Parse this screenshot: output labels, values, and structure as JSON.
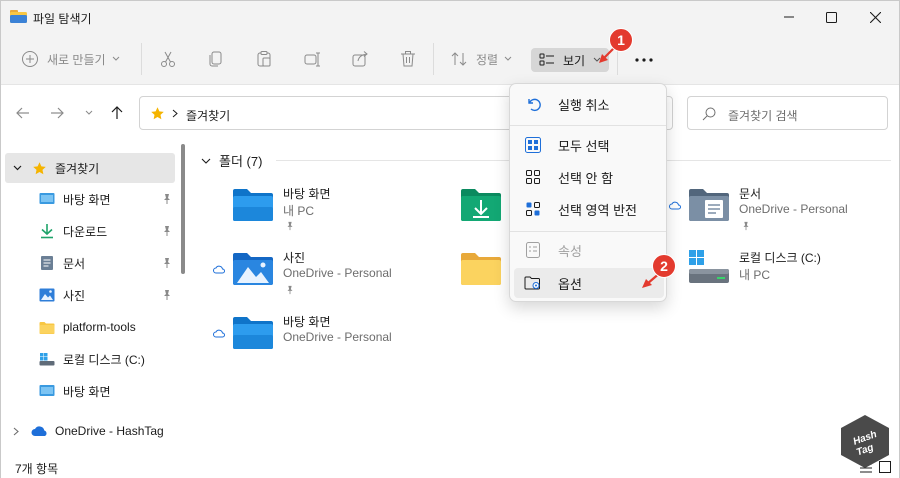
{
  "window": {
    "title": "파일 탐색기"
  },
  "toolbar": {
    "new_label": "새로 만들기",
    "sort_label": "정렬",
    "view_label": "보기"
  },
  "address": {
    "path": "즐겨찾기"
  },
  "search": {
    "placeholder": "즐겨찾기 검색"
  },
  "sidebar": {
    "items": [
      {
        "label": "즐겨찾기",
        "icon": "star-icon"
      },
      {
        "label": "바탕 화면",
        "icon": "desktop-icon"
      },
      {
        "label": "다운로드",
        "icon": "download-icon"
      },
      {
        "label": "문서",
        "icon": "document-icon"
      },
      {
        "label": "사진",
        "icon": "pictures-icon"
      },
      {
        "label": "platform-tools",
        "icon": "folder-icon"
      },
      {
        "label": "로컬 디스크 (C:)",
        "icon": "drive-icon"
      },
      {
        "label": "바탕 화면",
        "icon": "desktop-icon"
      },
      {
        "label": "OneDrive - HashTag",
        "icon": "onedrive-icon"
      }
    ]
  },
  "group": {
    "title": "폴더 (7)"
  },
  "tiles": [
    {
      "name": "바탕 화면",
      "sub": "내 PC",
      "icon": "desktop-folder-icon"
    },
    {
      "name": "",
      "sub": "",
      "icon": "download-folder-icon"
    },
    {
      "name": "문서",
      "sub": "OneDrive - Personal",
      "icon": "documents-folder-icon"
    },
    {
      "name": "사진",
      "sub": "OneDrive - Personal",
      "icon": "pictures-folder-icon"
    },
    {
      "name": "",
      "sub": "",
      "icon": "folder-icon"
    },
    {
      "name": "로컬 디스크 (C:)",
      "sub": "내 PC",
      "icon": "drive-icon"
    },
    {
      "name": "바탕 화면",
      "sub": "OneDrive - Personal",
      "icon": "desktop-folder-icon"
    }
  ],
  "menu": {
    "items": [
      {
        "label": "실행 취소",
        "icon": "undo-icon",
        "enabled": true
      },
      {
        "label": "모두 선택",
        "icon": "select-all-icon",
        "enabled": true
      },
      {
        "label": "선택 안 함",
        "icon": "select-none-icon",
        "enabled": true
      },
      {
        "label": "선택 영역 반전",
        "icon": "invert-selection-icon",
        "enabled": true
      },
      {
        "label": "속성",
        "icon": "properties-icon",
        "enabled": false
      },
      {
        "label": "옵션",
        "icon": "options-icon",
        "enabled": true
      }
    ]
  },
  "annotations": {
    "step1": "1",
    "step2": "2"
  },
  "status": {
    "text": "7개 항목"
  },
  "watermark": {
    "line1": "Hash",
    "line2": "Tag"
  },
  "colors": {
    "accent": "#0067c0",
    "folder_yellow": "#f8c744",
    "badge_red": "#e33a2e"
  }
}
